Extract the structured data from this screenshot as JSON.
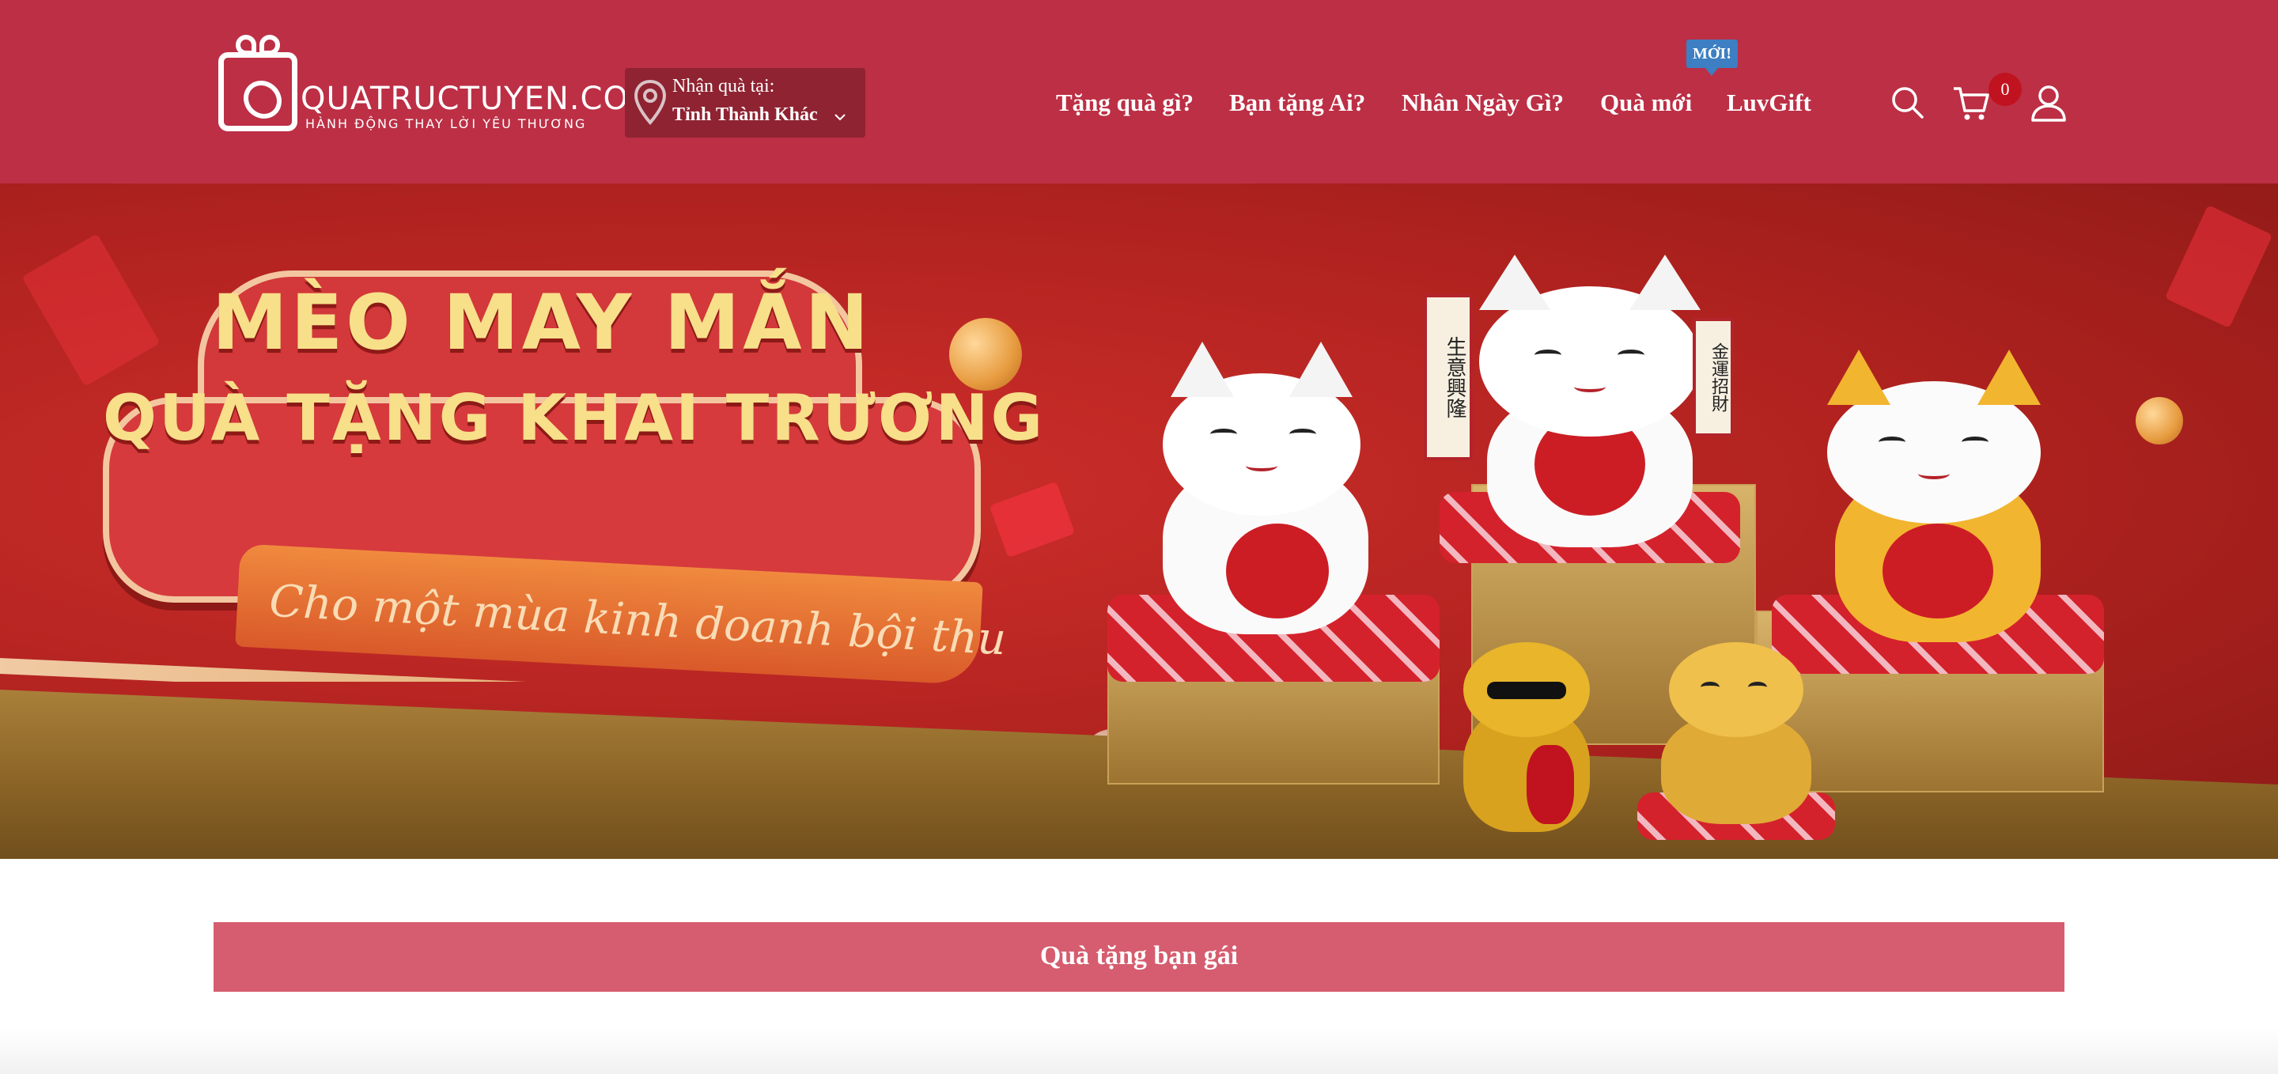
{
  "header": {
    "logo": {
      "name": "QUATRUCTUYEN.COM",
      "tagline": "HÀNH ĐỘNG THAY LỜI YÊU THƯƠNG"
    },
    "location": {
      "label": "Nhận quà tại:",
      "value": "Tỉnh Thành Khác"
    },
    "nav": [
      {
        "label": "Tặng quà gì?"
      },
      {
        "label": "Bạn tặng Ai?"
      },
      {
        "label": "Nhân Ngày Gì?"
      },
      {
        "label": "Quà mới"
      },
      {
        "label": "LuvGift"
      }
    ],
    "new_badge": "MỚI!",
    "icons": [
      "search-icon",
      "cart-icon",
      "user-icon"
    ],
    "cart_count": "0"
  },
  "banner": {
    "title_line1": "MÈO MAY MẮN",
    "title_line2": "QUÀ TẶNG KHAI TRƯƠNG",
    "subtitle": "Cho một mùa kinh doanh bội thu",
    "scroll_left": "生意興隆",
    "scroll_right": "金運招財",
    "slides": 3,
    "active_slide": 2
  },
  "section": {
    "title": "Quà tặng bạn gái"
  },
  "colors": {
    "header_bg": "#bc2f45",
    "location_bg": "#8f2332",
    "badge_blue": "#3d7fc2",
    "cart_badge": "#c1121f",
    "section_bar": "#d55d6f"
  }
}
